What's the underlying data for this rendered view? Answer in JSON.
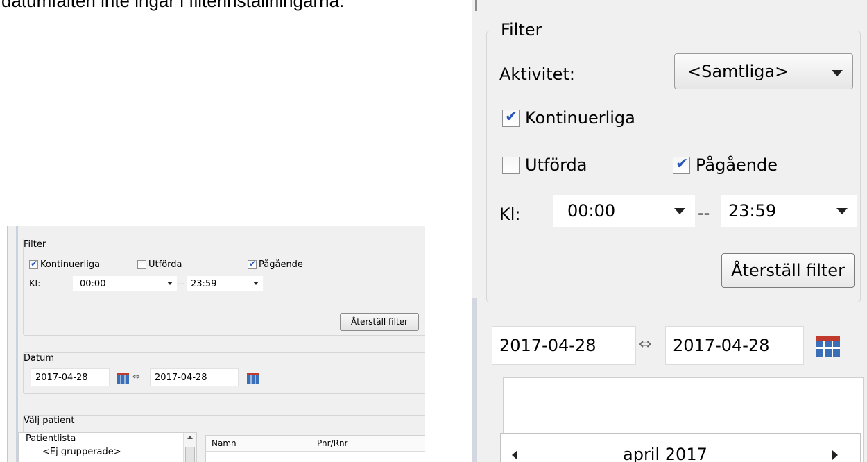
{
  "caption": "datumfälten inte ingår i filterinställningarna.",
  "small_panel": {
    "filter_legend": "Filter",
    "kontinuerliga_label": "Kontinuerliga",
    "utforda_label": "Utförda",
    "pagaende_label": "Pågående",
    "kl_label": "Kl:",
    "time_from": "00:00",
    "time_sep": "--",
    "time_to": "23:59",
    "reset_button": "Återställ filter",
    "datum_legend": "Datum",
    "date_from": "2017-04-28",
    "date_arrow": "⇔",
    "date_to": "2017-04-28",
    "patient_legend": "Välj patient",
    "patient_list_label": "Patientlista",
    "ungrouped_label": "<Ej grupperade>",
    "col_name": "Namn",
    "col_pnr": "Pnr/Rnr",
    "checks": {
      "kontinuerliga": true,
      "utforda": false,
      "pagaende": true
    }
  },
  "big_panel": {
    "filter_legend": "Filter",
    "aktivitet_label": "Aktivitet:",
    "aktivitet_value": "<Samtliga>",
    "kontinuerliga_label": "Kontinuerliga",
    "utforda_label": "Utförda",
    "pagaende_label": "Pågående",
    "kl_label": "Kl:",
    "time_from": "00:00",
    "time_sep": "--",
    "time_to": "23:59",
    "reset_button": "Återställ filter",
    "date_from": "2017-04-28",
    "date_arrow": "⇔",
    "date_to": "2017-04-28",
    "month_label": "april 2017",
    "checks": {
      "kontinuerliga": true,
      "utforda": false,
      "pagaende": true
    }
  },
  "colors": {
    "panel_bg": "#f0f0f0",
    "checkmark": "#2b57b8",
    "calendar_red": "#c23a2b",
    "calendar_blue": "#3a6fb8"
  }
}
